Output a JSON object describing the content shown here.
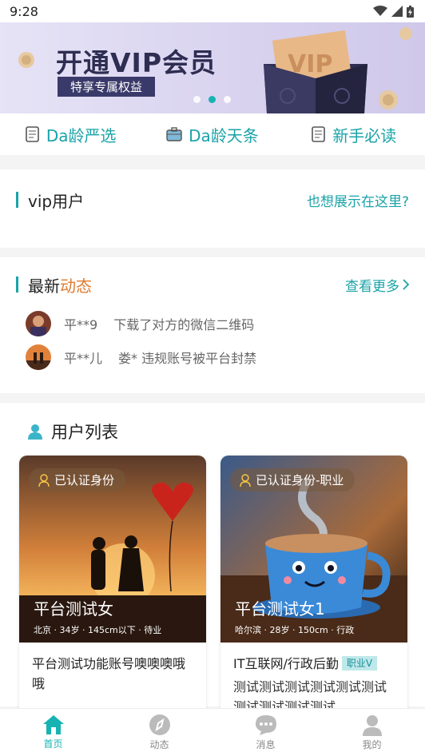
{
  "status": {
    "time": "9:28"
  },
  "banner": {
    "title": "开通VIP会员",
    "subtitle": "特享专属权益",
    "carousel_active": 2,
    "carousel_count": 3
  },
  "quicknav": [
    {
      "label": "Da龄严选",
      "icon": "document-icon"
    },
    {
      "label": "Da龄天条",
      "icon": "briefcase-icon"
    },
    {
      "label": "新手必读",
      "icon": "document-icon"
    }
  ],
  "vip": {
    "title": "vip用户",
    "link": "也想展示在这里?"
  },
  "news": {
    "title_prefix": "最新",
    "title_accent": "动态",
    "more": "查看更多",
    "items": [
      {
        "name": "平**9",
        "text": "下载了对方的微信二维码"
      },
      {
        "name": "平**儿",
        "text": "娄* 违规账号被平台封禁"
      }
    ]
  },
  "users": {
    "title": "用户列表",
    "cards": [
      {
        "badge": "已认证身份",
        "name": "平台测试女",
        "info": "北京 · 34岁 · 145cm以下 · 待业",
        "headline": "平台测试功能账号噢噢噢哦哦",
        "tag": "",
        "desc": ""
      },
      {
        "badge": "已认证身份-职业",
        "name": "平台测试女1",
        "info": "哈尔滨 · 28岁 · 150cm · 行政",
        "headline": "IT互联网/行政后勤",
        "tag": "职业V",
        "desc": "测试测试测试测试测试测试测试测试测试测试"
      }
    ]
  },
  "tabbar": [
    {
      "label": "首页",
      "active": true
    },
    {
      "label": "动态",
      "active": false
    },
    {
      "label": "消息",
      "active": false
    },
    {
      "label": "我的",
      "active": false
    }
  ],
  "colors": {
    "accent": "#1aa3a8",
    "tab_active": "#17b3b3",
    "highlight": "#e07a2e"
  }
}
